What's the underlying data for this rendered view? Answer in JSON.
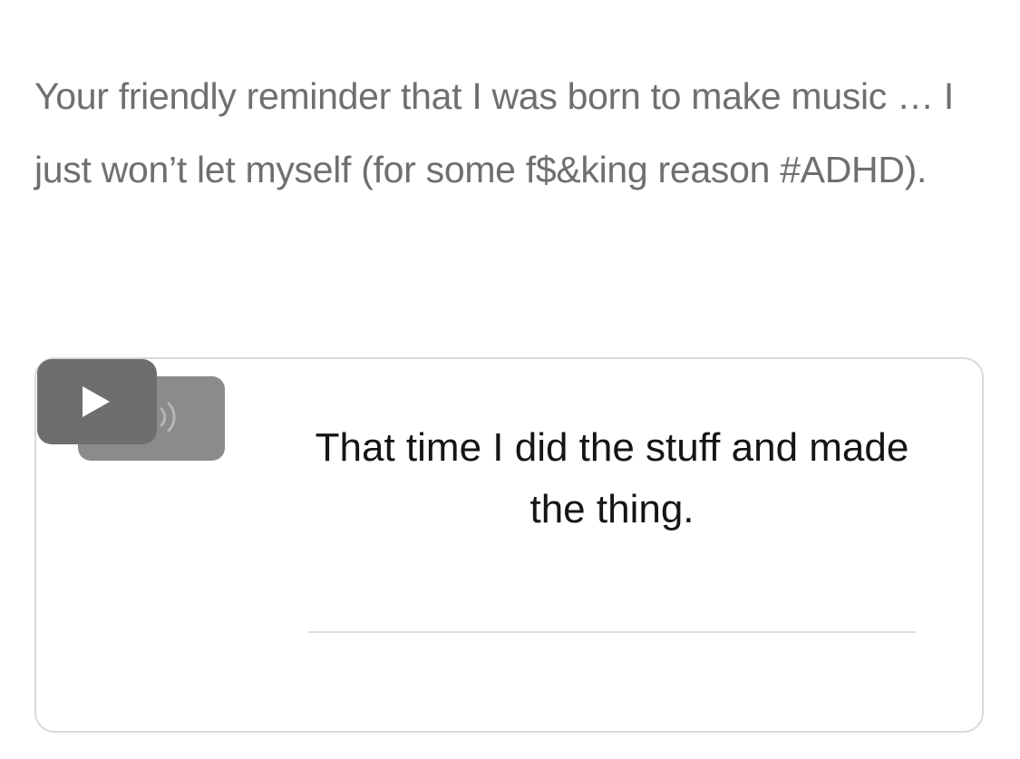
{
  "intro": {
    "text": "Your friendly reminder that I was born to make music … I just won’t let myself (for some f$&king reason #ADHD)."
  },
  "player": {
    "play_icon": "play-icon",
    "volume_icon": "speaker-waves-icon",
    "track_title": "That time I did the stuff and made the thing.",
    "colors": {
      "play_button": "#6e6e6e",
      "volume_button": "#8b8b8b",
      "card_border": "#d9d9d9"
    }
  }
}
